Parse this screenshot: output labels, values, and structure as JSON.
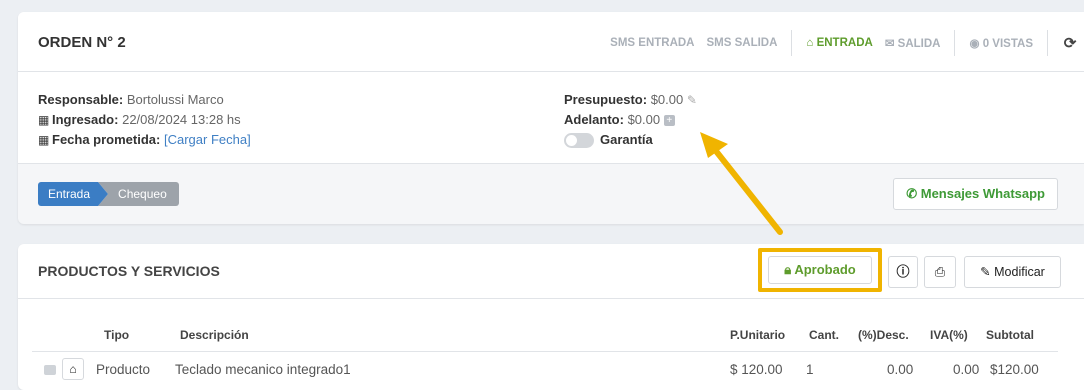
{
  "order": {
    "title": "ORDEN N° 2",
    "links": {
      "sms_entrada": "SMS ENTRADA",
      "sms_salida": "SMS SALIDA",
      "entrada": "ENTRADA",
      "salida": "SALIDA",
      "vistas": "0 VISTAS"
    },
    "left": {
      "responsable_label": "Responsable:",
      "responsable_value": "Bortolussi Marco",
      "ingresado_label": "Ingresado:",
      "ingresado_value": "22/08/2024 13:28 hs",
      "fecha_label": "Fecha prometida:",
      "fecha_link": "[Cargar Fecha]"
    },
    "right": {
      "presupuesto_label": "Presupuesto:",
      "presupuesto_value": "$0.00",
      "adelanto_label": "Adelanto:",
      "adelanto_value": "$0.00",
      "garantia_label": "Garantía"
    },
    "steps": [
      "Entrada",
      "Chequeo"
    ],
    "whatsapp_button": "Mensajes Whatsapp"
  },
  "products": {
    "title": "PRODUCTOS Y SERVICIOS",
    "status_button": "Aprobado",
    "modify_button": "Modificar",
    "columns": [
      "Tipo",
      "Descripción",
      "P.Unitario",
      "Cant.",
      "(%)Desc.",
      "IVA(%)",
      "Subtotal"
    ],
    "rows": [
      {
        "tipo": "Producto",
        "descripcion": "Teclado mecanico integrado1",
        "unitario": "$ 120.00",
        "cant": "1",
        "desc": "0.00",
        "iva": "0.00",
        "subtotal": "$120.00"
      }
    ]
  },
  "colors": {
    "accent_green": "#5e9c2c",
    "whatsapp_green": "#3e9a36",
    "step_active": "#3b7dc4",
    "step_inactive": "#9da3aa",
    "highlight_annotation": "#f0b400"
  },
  "icons": [
    "refresh-icon",
    "store-icon",
    "envelope-icon",
    "eye-icon",
    "calendar-icon",
    "pencil-icon",
    "plus-square-icon",
    "whatsapp-icon",
    "lock-icon",
    "info-icon",
    "print-icon",
    "pencil-icon",
    "basket-icon",
    "drag-handle-icon"
  ]
}
